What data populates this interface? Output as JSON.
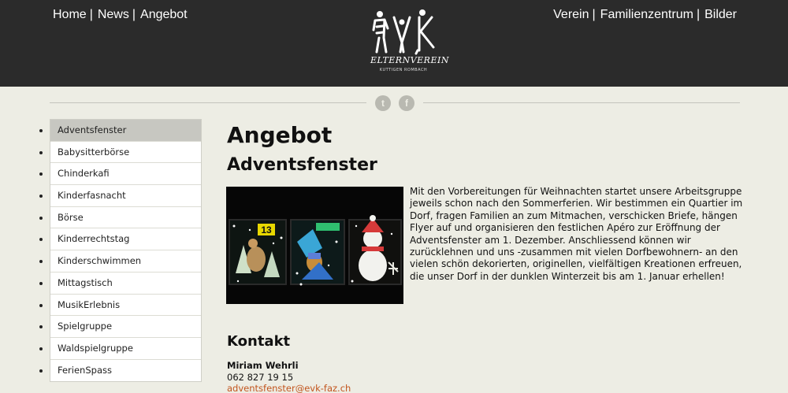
{
  "nav": {
    "left": [
      "Home",
      "News",
      "Angebot"
    ],
    "right": [
      "Verein",
      "Familienzentrum",
      "Bilder"
    ],
    "separator": "|"
  },
  "logo": {
    "initials": "EVK",
    "name": "ELTERNVEREIN",
    "subtitle": "KUTTIGEN ROMBACH"
  },
  "social": {
    "twitter_icon": "twitter-icon",
    "facebook_icon": "facebook-icon"
  },
  "sidebar": {
    "items": [
      {
        "label": "Adventsfenster",
        "active": true
      },
      {
        "label": "Babysitterbörse"
      },
      {
        "label": "Chinderkafi"
      },
      {
        "label": "Kinderfasnacht"
      },
      {
        "label": "Börse"
      },
      {
        "label": "Kinderrechtstag"
      },
      {
        "label": "Kinderschwimmen"
      },
      {
        "label": "Mittagstisch"
      },
      {
        "label": "MusikErlebnis"
      },
      {
        "label": "Spielgruppe"
      },
      {
        "label": "Waldspielgruppe"
      },
      {
        "label": "FerienSpass"
      }
    ]
  },
  "main": {
    "page_title": "Angebot",
    "section_title": "Adventsfenster",
    "photo_number": "13",
    "body": "Mit den Vorbereitungen für Weihnachten startet unsere Arbeitsgruppe jeweils schon nach den Sommerferien. Wir bestimmen ein Quartier im Dorf, fragen Familien an zum Mitmachen, verschicken Briefe, hängen Flyer auf und organisieren den festlichen Apéro zur Eröffnung der Adventsfenster am 1. Dezember. Anschliessend können wir zurücklehnen und uns -zusammen mit vielen Dorfbewohnern- an den vielen schön dekorierten, originellen, vielfältigen Kreationen erfreuen, die unser Dorf in der dunklen Winterzeit bis am 1. Januar erhellen!"
  },
  "contact": {
    "title": "Kontakt",
    "name": "Miriam Wehrli",
    "phone": "062 827 19 15",
    "email": "adventsfenster@evk-faz.ch"
  },
  "colors": {
    "header_bg": "#2b2b2b",
    "page_bg": "#edede4",
    "link_accent": "#c2551e",
    "sidebar_active": "#c7c7c1"
  }
}
